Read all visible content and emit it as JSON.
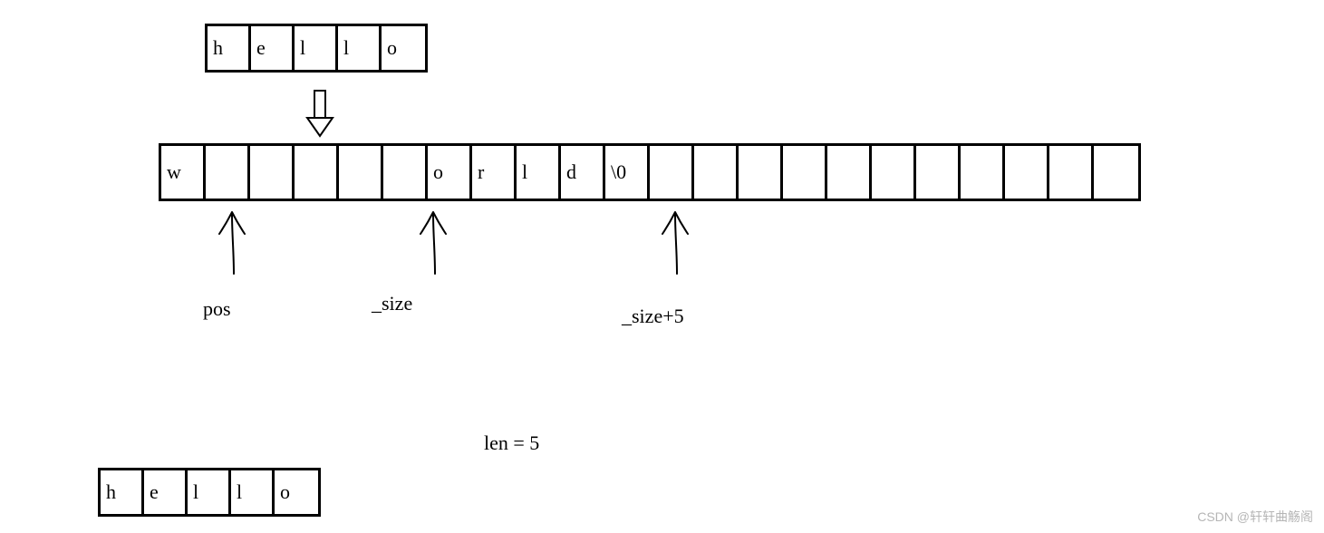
{
  "small_array_top": {
    "cells": [
      "h",
      "e",
      "l",
      "l",
      "o"
    ]
  },
  "long_array": {
    "cells": [
      "w",
      "",
      "",
      "",
      "",
      "",
      "o",
      "r",
      "l",
      "d",
      "\\0",
      "",
      "",
      "",
      "",
      "",
      "",
      "",
      "",
      "",
      "",
      ""
    ]
  },
  "small_array_bottom": {
    "cells": [
      "h",
      "e",
      "l",
      "l",
      "o"
    ]
  },
  "labels": {
    "pos": "pos",
    "size": "_size",
    "size_plus": "_size+5",
    "len": "len = 5"
  },
  "watermark": "CSDN @轩轩曲觞阁"
}
